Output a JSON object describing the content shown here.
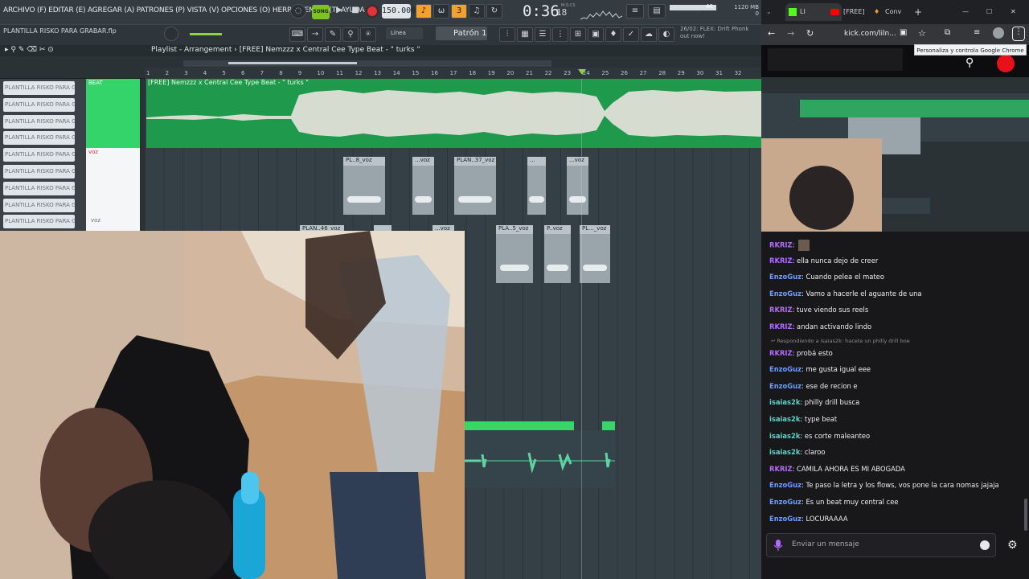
{
  "fl": {
    "menus": "ARCHIVO (F) EDITAR (E) AGREGAR (A) PATRONES (P) VISTA (V) OPCIONES (O) HERRAMIENTAS (T) AYUDA",
    "song_label": "SONG",
    "tempo": "150.000",
    "time": "0:36",
    "time_frac": "18",
    "mcs_label": "M:S:CS",
    "memory": "1120 MB",
    "memory_sub": "0",
    "volume": "40",
    "project_name": "PLANTILLA RISKO PARA GRABAR.flp",
    "line_mode": "Línea",
    "pattern": "Patrón 1",
    "news": "26/02: FLEX: Drift Phonk out now!",
    "playlist_title": "Playlist - Arrangement",
    "playlist_breadcrumb": "› [FREE] Nemzzz x Central Cee Type Beat - \" turks \"",
    "ruler": [
      "1",
      "2",
      "3",
      "4",
      "5",
      "6",
      "7",
      "8",
      "9",
      "10",
      "11",
      "12",
      "13",
      "14",
      "15",
      "16",
      "17",
      "18",
      "19",
      "20",
      "21",
      "22",
      "23",
      "24",
      "25",
      "26",
      "27",
      "28",
      "29",
      "30",
      "31",
      "32"
    ],
    "channels": [
      "PLANTILLA RISKO PARA GR...",
      "PLANTILLA RISKO PARA GR...",
      "PLANTILLA RISKO PARA GR...",
      "PLANTILLA RISKO PARA GR...",
      "PLANTILLA RISKO PARA GR...",
      "PLANTILLA RISKO PARA GR...",
      "PLANTILLA RISKO PARA GR...",
      "PLANTILLA RISKO PARA GR...",
      "PLANTILLA RISKO PARA GR..."
    ],
    "tracks": {
      "beat": "BEAT",
      "voz": "voz",
      "voz2": "voz"
    },
    "beat_clip_title": "[FREE] Nemzzz x Central Cee Type Beat - \" turks \"",
    "voz_clips_row1": [
      "PL..8_voz",
      "...voz",
      "PLAN..37_voz",
      "...",
      "...voz"
    ],
    "voz_clips_row2": [
      "PLAN..46_voz",
      "",
      "...voz",
      "PLA..5_voz",
      "P..voz",
      "PL..._voz"
    ]
  },
  "chrome": {
    "tabs": [
      "LI",
      "[FREE]",
      "Conv"
    ],
    "url": "kick.com/liln...",
    "tooltip": "Personaliza y controla Google Chrome",
    "chat": [
      {
        "user": "RKRIZ",
        "text": "",
        "color": "purple"
      },
      {
        "user": "RKRIZ",
        "text": "ella nunca dejo de creer",
        "color": "purple"
      },
      {
        "user": "EnzoGuz",
        "text": "Cuando pelea el mateo",
        "color": "blue"
      },
      {
        "user": "EnzoGuz",
        "text": "Vamo a hacerle el aguante de una",
        "color": "blue"
      },
      {
        "user": "RKRIZ",
        "text": "tuve viendo sus reels",
        "color": "purple"
      },
      {
        "user": "RKRIZ",
        "text": "andan activando lindo",
        "color": "purple"
      },
      {
        "user": "RKRIZ",
        "text": "probá esto",
        "color": "purple"
      },
      {
        "user": "EnzoGuz",
        "text": "me gusta igual eee",
        "color": "blue"
      },
      {
        "user": "EnzoGuz",
        "text": "ese de recion e",
        "color": "blue"
      },
      {
        "user": "isaias2k",
        "text": "philly drill busca",
        "color": "teal"
      },
      {
        "user": "isaias2k",
        "text": "type beat",
        "color": "teal"
      },
      {
        "user": "isaias2k",
        "text": "es corte maleanteo",
        "color": "teal"
      },
      {
        "user": "isaias2k",
        "text": "claroo",
        "color": "teal"
      },
      {
        "user": "RKRIZ",
        "text": "CAMILA AHORA ES MI ABOGADA",
        "color": "purple"
      },
      {
        "user": "EnzoGuz",
        "text": "Te paso la letra y los flows, vos pone la cara nomas jajaja",
        "color": "blue"
      },
      {
        "user": "EnzoGuz",
        "text": "Es un beat muy central cee",
        "color": "blue"
      },
      {
        "user": "EnzoGuz",
        "text": "LOCURAAAA",
        "color": "blue"
      }
    ],
    "reply_note": "Respondiendo a isaias2k: hacete un philly drill boe",
    "chat_placeholder": "Enviar un mensaje"
  }
}
